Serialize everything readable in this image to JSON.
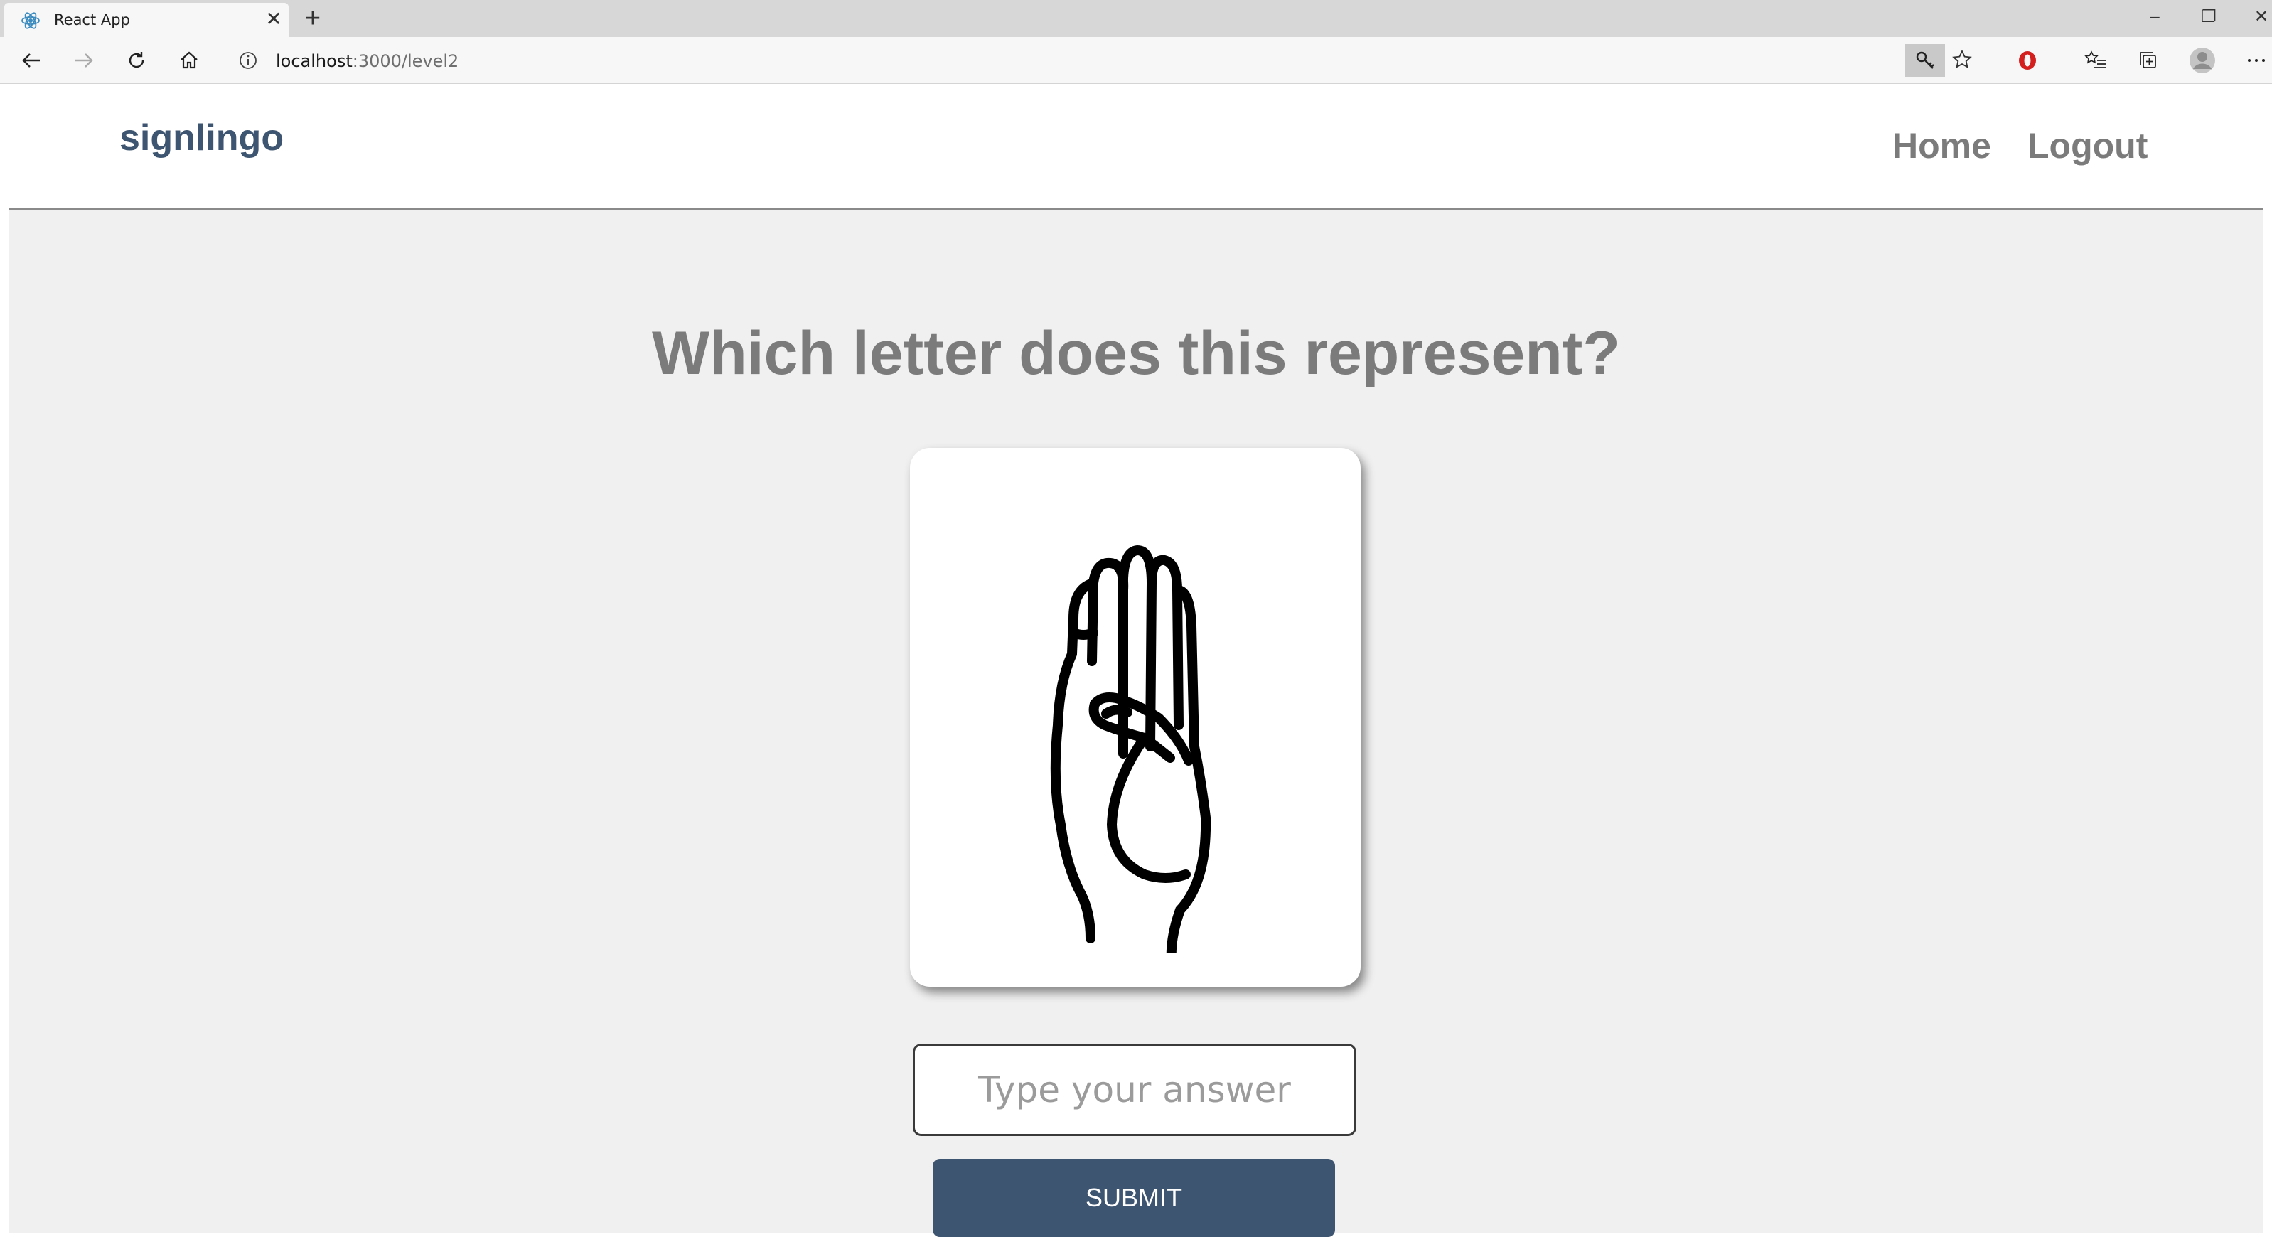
{
  "browser": {
    "tab_title": "React App",
    "tab_close": "✕",
    "new_tab": "+",
    "address_host": "localhost",
    "address_path": ":3000/level2",
    "window_controls": [
      "–",
      "❐",
      "✕"
    ],
    "toolbar_icons": [
      "back-icon",
      "forward-icon",
      "refresh-icon",
      "home-icon",
      "key-icon",
      "star-icon",
      "opera-icon",
      "favorites-icon",
      "collections-icon",
      "profile-icon",
      "more-icon"
    ]
  },
  "nav": {
    "brand": "signlingo",
    "links": [
      "Home",
      "Logout"
    ]
  },
  "quiz": {
    "question": "Which letter does this represent?",
    "image": "hand-sign-b",
    "answer_placeholder": "Type your answer",
    "submit_label": "SUBMIT"
  },
  "colors": {
    "brand": "#3d5570",
    "page_bg": "#f0f0f0",
    "muted_text": "#7b7b7b"
  }
}
